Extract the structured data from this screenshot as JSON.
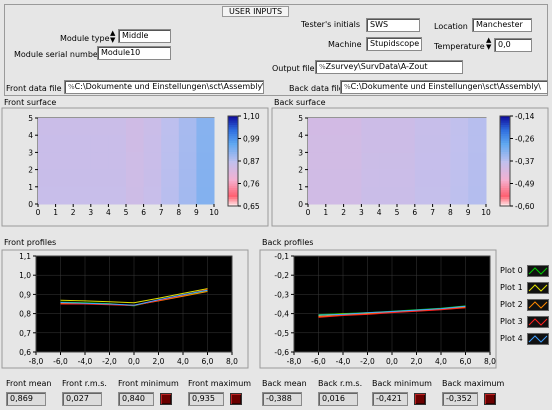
{
  "user_inputs": {
    "title": "USER INPUTS",
    "module_type_label": "Module type",
    "module_type_value": "Middle",
    "module_serial_label": "Module serial number",
    "module_serial_value": "Module10",
    "tester_label": "Tester's initials",
    "tester_value": "SWS",
    "location_label": "Location",
    "location_value": "Manchester",
    "machine_label": "Machine",
    "machine_value": "Stupidscope",
    "temperature_label": "Temperature",
    "temperature_value": "0,0",
    "output_file_label": "Output file",
    "output_file_value": "Zsurvey\\SurvData\\A-Zout",
    "back_data_file_label": "Back data file",
    "back_data_file_value": "C:\\Dokumente und Einstellungen\\sct\\Assembly\\",
    "front_data_file_label": "Front data file",
    "front_data_file_value": "C:\\Dokumente und Einstellungen\\sct\\Assembly\\",
    "path_prefix_symbol": "%"
  },
  "front_surface": {
    "title": "Front surface",
    "x_ticks": [
      "0",
      "1",
      "2",
      "3",
      "4",
      "5",
      "6",
      "7",
      "8",
      "9",
      "10"
    ],
    "y_ticks": [
      "0",
      "1",
      "2",
      "3",
      "4",
      "5"
    ],
    "scale_ticks": [
      "1,10",
      "0,99",
      "0,87",
      "0,76",
      "0,65"
    ]
  },
  "back_surface": {
    "title": "Back surface",
    "x_ticks": [
      "0",
      "1",
      "2",
      "3",
      "4",
      "5",
      "6",
      "7",
      "8",
      "9",
      "10"
    ],
    "y_ticks": [
      "0",
      "1",
      "2",
      "3",
      "4",
      "5"
    ],
    "scale_ticks": [
      "-0,14",
      "-0,26",
      "-0,37",
      "-0,49",
      "-0,60"
    ]
  },
  "front_profiles": {
    "title": "Front profiles",
    "x_ticks": [
      "-8,0",
      "-6,0",
      "-4,0",
      "-2,0",
      "0,0",
      "2,0",
      "4,0",
      "6,0",
      "8,0"
    ],
    "y_ticks": [
      "1,1",
      "1,0",
      "0,9",
      "0,8",
      "0,7",
      "0,6"
    ]
  },
  "back_profiles": {
    "title": "Back profiles",
    "x_ticks": [
      "-8,0",
      "-6,0",
      "-4,0",
      "-2,0",
      "0,0",
      "2,0",
      "4,0",
      "6,0",
      "8,0"
    ],
    "y_ticks": [
      "-0,1",
      "-0,2",
      "-0,3",
      "-0,4",
      "-0,5",
      "-0,6"
    ]
  },
  "legend": {
    "items": [
      {
        "label": "Plot 0",
        "color": "#00cc00"
      },
      {
        "label": "Plot 1",
        "color": "#e0e000"
      },
      {
        "label": "Plot 2",
        "color": "#ff8800"
      },
      {
        "label": "Plot 3",
        "color": "#ff2020"
      },
      {
        "label": "Plot 4",
        "color": "#40a0ff"
      }
    ]
  },
  "stats": {
    "front_mean_label": "Front mean",
    "front_mean_value": "0,869",
    "front_rms_label": "Front r.m.s.",
    "front_rms_value": "0,027",
    "front_min_label": "Front minimum",
    "front_min_value": "0,840",
    "front_max_label": "Front maximum",
    "front_max_value": "0,935",
    "back_mean_label": "Back mean",
    "back_mean_value": "-0,388",
    "back_rms_label": "Back r.m.s.",
    "back_rms_value": "0,016",
    "back_min_label": "Back minimum",
    "back_min_value": "-0,421",
    "back_max_label": "Back maximum",
    "back_max_value": "-0,352"
  },
  "chart_data": [
    {
      "type": "heatmap",
      "title": "Front surface",
      "xlim": [
        0,
        10
      ],
      "ylim": [
        0,
        5
      ],
      "colorscale_range": [
        0.65,
        1.1
      ],
      "x": [
        0,
        1,
        2,
        3,
        4,
        5,
        6,
        7,
        8,
        9,
        10
      ],
      "rows": 5,
      "columns": 10,
      "values_row_profile": [
        0.86,
        0.86,
        0.86,
        0.86,
        0.86,
        0.85,
        0.86,
        0.88,
        0.9,
        0.93
      ]
    },
    {
      "type": "heatmap",
      "title": "Back surface",
      "xlim": [
        0,
        10
      ],
      "ylim": [
        0,
        5
      ],
      "colorscale_range": [
        -0.6,
        -0.14
      ],
      "x": [
        0,
        1,
        2,
        3,
        4,
        5,
        6,
        7,
        8,
        9,
        10
      ],
      "rows": 5,
      "columns": 10,
      "values_row_profile": [
        -0.4,
        -0.4,
        -0.4,
        -0.39,
        -0.39,
        -0.39,
        -0.38,
        -0.38,
        -0.37,
        -0.36
      ]
    },
    {
      "type": "line",
      "title": "Front profiles",
      "xlim": [
        -8,
        8
      ],
      "ylim": [
        0.6,
        1.1
      ],
      "x": [
        -6,
        -4,
        -2,
        0,
        2,
        4,
        6
      ],
      "series": [
        {
          "name": "Plot 0",
          "color": "#00cc00",
          "values": [
            0.86,
            0.857,
            0.852,
            0.84,
            0.87,
            0.895,
            0.92
          ]
        },
        {
          "name": "Plot 1",
          "color": "#e0e000",
          "values": [
            0.87,
            0.866,
            0.862,
            0.856,
            0.88,
            0.905,
            0.93
          ]
        },
        {
          "name": "Plot 2",
          "color": "#ff8800",
          "values": [
            0.855,
            0.852,
            0.848,
            0.843,
            0.866,
            0.89,
            0.915
          ]
        },
        {
          "name": "Plot 3",
          "color": "#ff2020",
          "values": [
            0.85,
            0.85,
            0.846,
            0.842,
            0.868,
            0.896,
            0.925
          ]
        },
        {
          "name": "Plot 4",
          "color": "#40a0ff",
          "values": [
            0.858,
            0.854,
            0.85,
            0.844,
            0.872,
            0.898,
            0.922
          ]
        }
      ]
    },
    {
      "type": "line",
      "title": "Back profiles",
      "xlim": [
        -8,
        8
      ],
      "ylim": [
        -0.6,
        -0.1
      ],
      "x": [
        -6,
        -4,
        -2,
        0,
        2,
        4,
        6
      ],
      "series": [
        {
          "name": "Plot 0",
          "color": "#00cc00",
          "values": [
            -0.405,
            -0.4,
            -0.395,
            -0.388,
            -0.38,
            -0.372,
            -0.36
          ]
        },
        {
          "name": "Plot 1",
          "color": "#e0e000",
          "values": [
            -0.41,
            -0.402,
            -0.398,
            -0.39,
            -0.384,
            -0.376,
            -0.365
          ]
        },
        {
          "name": "Plot 2",
          "color": "#ff8800",
          "values": [
            -0.415,
            -0.408,
            -0.4,
            -0.392,
            -0.386,
            -0.378,
            -0.368
          ]
        },
        {
          "name": "Plot 3",
          "color": "#ff2020",
          "values": [
            -0.42,
            -0.41,
            -0.404,
            -0.395,
            -0.388,
            -0.38,
            -0.37
          ]
        },
        {
          "name": "Plot 4",
          "color": "#40a0ff",
          "values": [
            -0.408,
            -0.404,
            -0.396,
            -0.389,
            -0.382,
            -0.374,
            -0.362
          ]
        }
      ]
    }
  ]
}
